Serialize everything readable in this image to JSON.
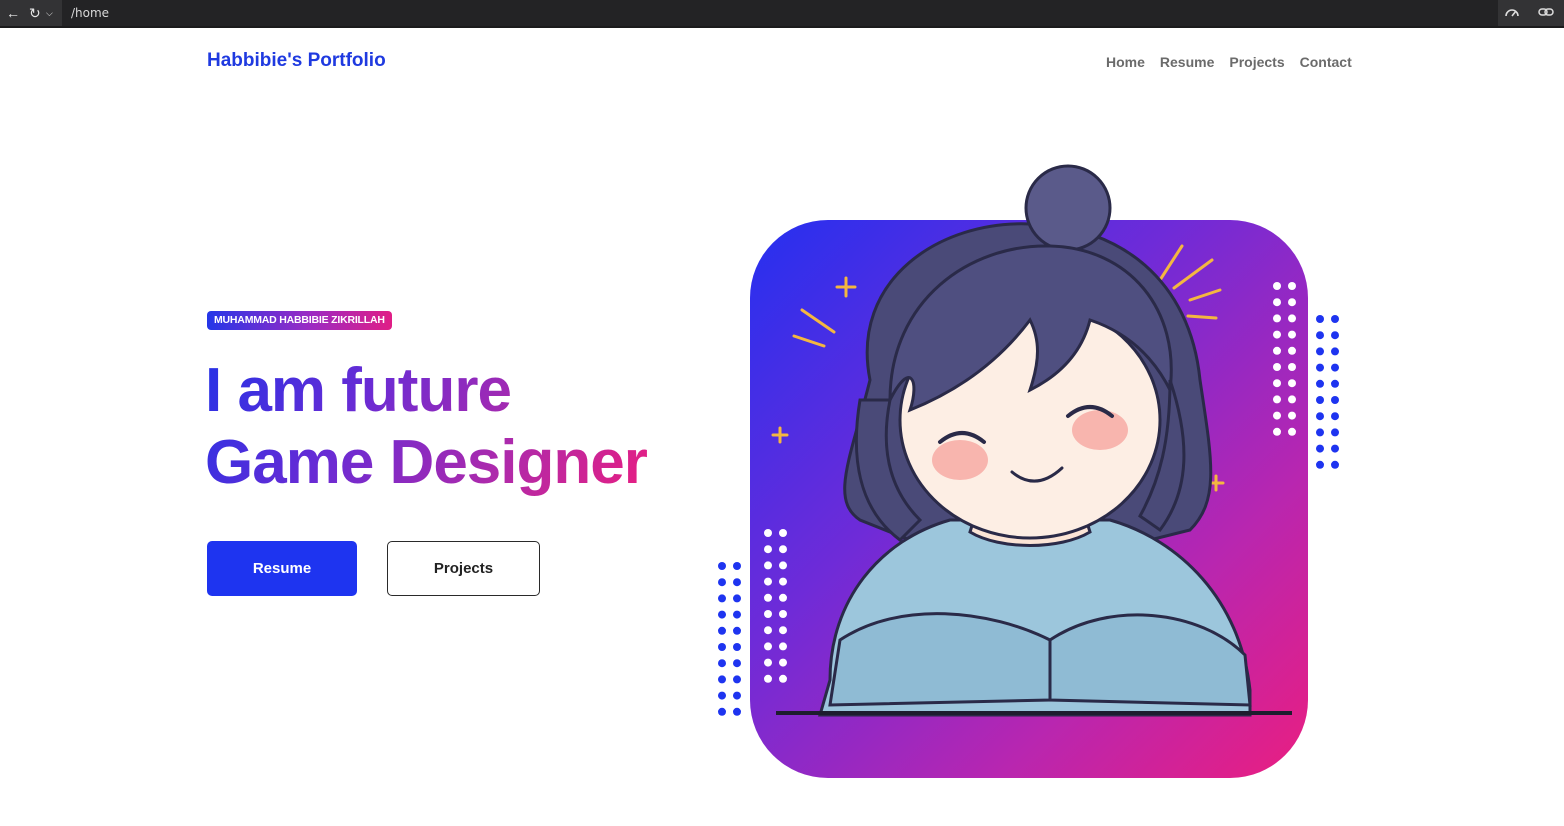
{
  "browser": {
    "url": "/home",
    "icons": [
      "back-icon",
      "reload-icon",
      "dropdown-icon",
      "performance-icon",
      "link-icon"
    ]
  },
  "nav": {
    "brand": "Habbibie's Portfolio",
    "links": [
      "Home",
      "Resume",
      "Projects",
      "Contact"
    ]
  },
  "hero": {
    "badge": "MUHAMMAD HABBIBIE ZIKRILLAH",
    "line1": "I am future",
    "line2": "Game Designer",
    "buttons": {
      "primary": "Resume",
      "secondary": "Projects"
    }
  },
  "colors": {
    "brand_blue": "#1f3ae0",
    "gradient_start": "#2530f0",
    "gradient_mid": "#8a2bd0",
    "gradient_end": "#ea1e80",
    "dot_blue": "#1e34f0"
  }
}
